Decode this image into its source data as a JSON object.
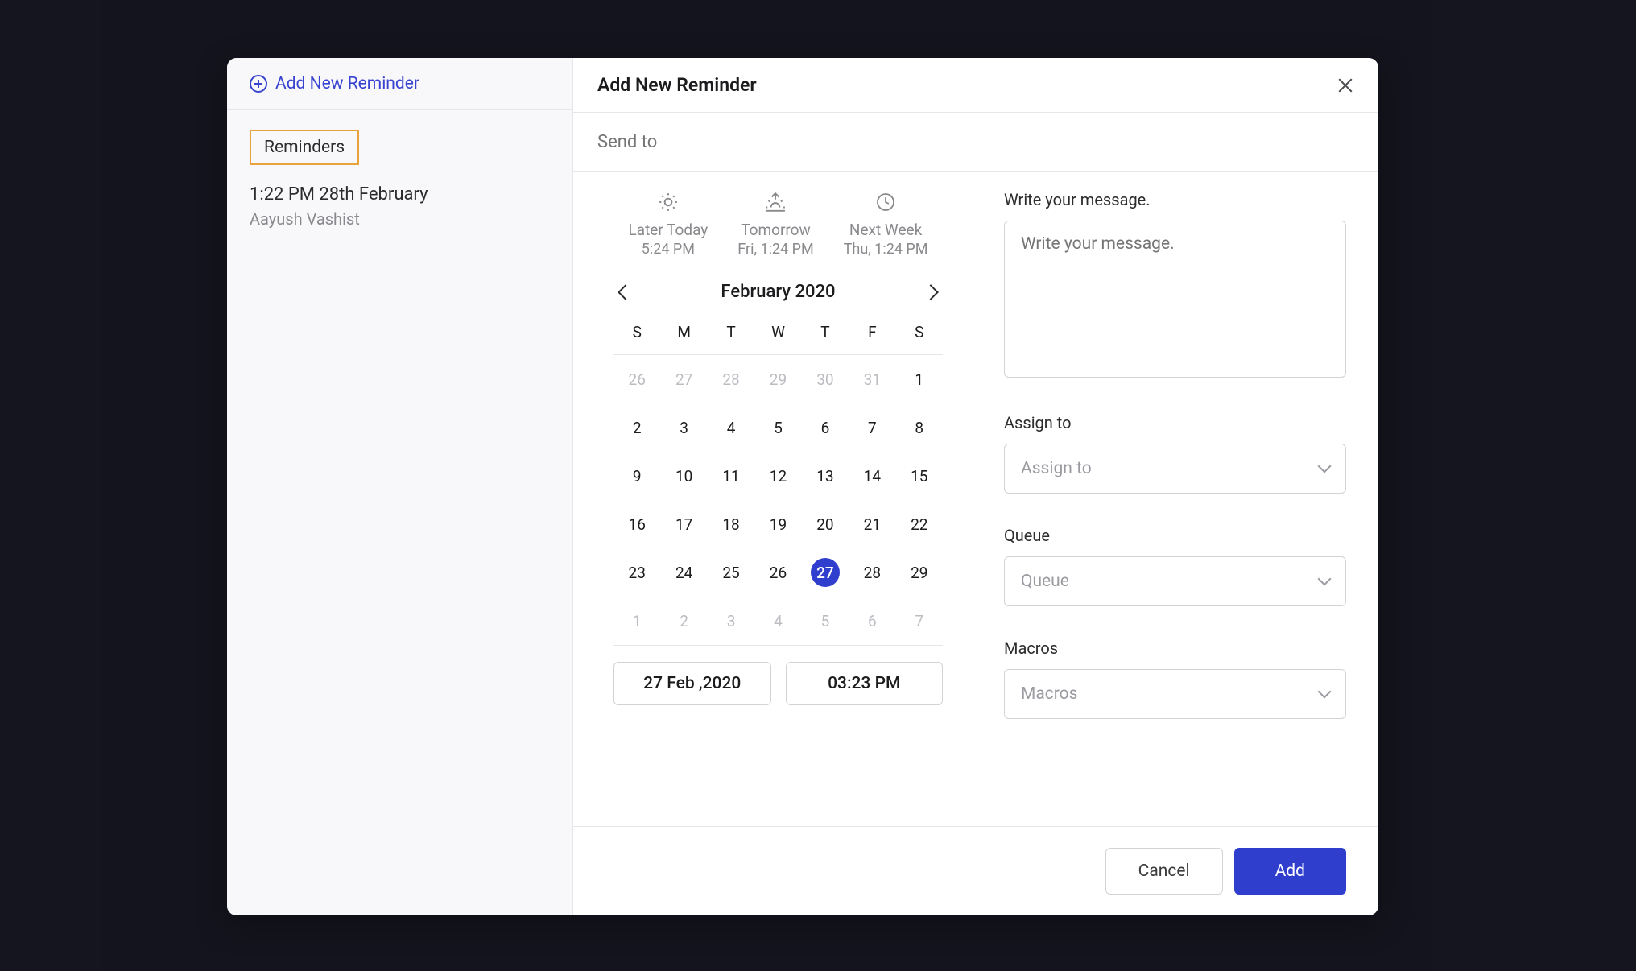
{
  "sidebar": {
    "add_label": "Add New Reminder",
    "tab_label": "Reminders",
    "items": [
      {
        "time": "1:22 PM 28th February",
        "user": "Aayush Vashist"
      }
    ]
  },
  "header": {
    "title": "Add New Reminder"
  },
  "send_to": {
    "placeholder": "Send to"
  },
  "quick_picks": [
    {
      "label": "Later Today",
      "time": "5:24 PM"
    },
    {
      "label": "Tomorrow",
      "time": "Fri, 1:24 PM"
    },
    {
      "label": "Next Week",
      "time": "Thu, 1:24 PM"
    }
  ],
  "calendar": {
    "month_label": "February 2020",
    "dow": [
      "S",
      "M",
      "T",
      "W",
      "T",
      "F",
      "S"
    ],
    "rows": [
      [
        {
          "n": "26",
          "muted": true
        },
        {
          "n": "27",
          "muted": true
        },
        {
          "n": "28",
          "muted": true
        },
        {
          "n": "29",
          "muted": true
        },
        {
          "n": "30",
          "muted": true
        },
        {
          "n": "31",
          "muted": true
        },
        {
          "n": "1"
        }
      ],
      [
        {
          "n": "2"
        },
        {
          "n": "3"
        },
        {
          "n": "4"
        },
        {
          "n": "5"
        },
        {
          "n": "6"
        },
        {
          "n": "7"
        },
        {
          "n": "8"
        }
      ],
      [
        {
          "n": "9"
        },
        {
          "n": "10"
        },
        {
          "n": "11"
        },
        {
          "n": "12"
        },
        {
          "n": "13"
        },
        {
          "n": "14"
        },
        {
          "n": "15"
        }
      ],
      [
        {
          "n": "16"
        },
        {
          "n": "17"
        },
        {
          "n": "18"
        },
        {
          "n": "19"
        },
        {
          "n": "20"
        },
        {
          "n": "21"
        },
        {
          "n": "22"
        }
      ],
      [
        {
          "n": "23"
        },
        {
          "n": "24"
        },
        {
          "n": "25"
        },
        {
          "n": "26"
        },
        {
          "n": "27",
          "sel": true
        },
        {
          "n": "28"
        },
        {
          "n": "29"
        }
      ],
      [
        {
          "n": "1",
          "muted": true
        },
        {
          "n": "2",
          "muted": true
        },
        {
          "n": "3",
          "muted": true
        },
        {
          "n": "4",
          "muted": true
        },
        {
          "n": "5",
          "muted": true
        },
        {
          "n": "6",
          "muted": true
        },
        {
          "n": "7",
          "muted": true
        }
      ]
    ],
    "date_box": "27 Feb ,2020",
    "time_box": "03:23 PM"
  },
  "message": {
    "label": "Write your message.",
    "placeholder": "Write your message."
  },
  "assign": {
    "label": "Assign to",
    "placeholder": "Assign to"
  },
  "queue": {
    "label": "Queue",
    "placeholder": "Queue"
  },
  "macros": {
    "label": "Macros",
    "placeholder": "Macros"
  },
  "footer": {
    "cancel": "Cancel",
    "add": "Add"
  }
}
